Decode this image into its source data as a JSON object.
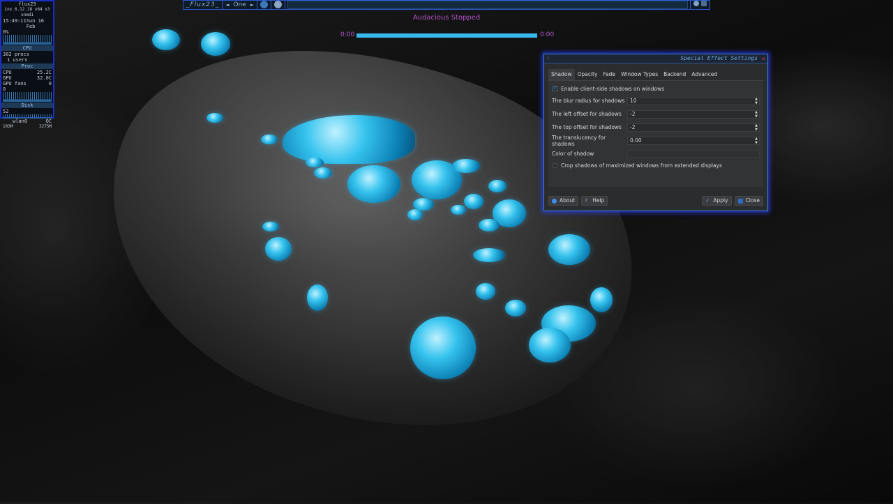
{
  "conky": {
    "hostname": "flux23",
    "kernel": "Lnx 6.12.18 x64 x3 xnmd1",
    "time": "15:49:11",
    "date": "Sun 16 Feb",
    "cpu_pct": "0%",
    "cpu_header": "CPU",
    "procs": "302 procs",
    "users": "1 users",
    "proc_header": "Proc",
    "cpu_temp_label": "CPU",
    "cpu_temp": "25.2C",
    "gpu_temp_label": "GPU",
    "gpu_temp": "32.0C",
    "gpu_fans_label": "GPU fans",
    "gpu_fans": "0",
    "disk_zero": "0",
    "disk_header": "Disk",
    "disk_val": "52",
    "net_iface": "wlan0",
    "net_state": "OC",
    "net_down": "103M",
    "net_up": "3275M"
  },
  "toolbar": {
    "title": "_Flux23_",
    "workspace": "One",
    "prev_arrow": "◄",
    "next_arrow": "►"
  },
  "audacious": {
    "status": "Audacious  Stopped",
    "elapsed": "0:00",
    "total": "0:00",
    "progress": 1.0
  },
  "dialog": {
    "title": "Special Effect Settings",
    "tabs": [
      "Shadow",
      "Opacity",
      "Fade",
      "Window Types",
      "Backend",
      "Advanced"
    ],
    "active_tab": "Shadow",
    "enable_shadows_label": "Enable client-side shadows on windows",
    "enable_shadows_checked": true,
    "blur_label": "The blur radius for shadows",
    "blur_value": "10",
    "left_label": "The left offset for shadows",
    "left_value": "-2",
    "top_label": "The top offset for shadows",
    "top_value": "-2",
    "translucency_label": "The translucency for shadows",
    "translucency_value": "0.00",
    "color_label": "Color of shadow",
    "crop_label": "Crop shadows of maximized windows from extended displays",
    "crop_checked": false,
    "about_label": "About",
    "help_label": "Help",
    "apply_label": "Apply",
    "close_label": "Close"
  },
  "colors": {
    "accent_blue": "#2a5bdc",
    "audacious_text": "#b455c9",
    "progress": "#38b9ee",
    "dialog_bg": "#2b2c2e"
  }
}
